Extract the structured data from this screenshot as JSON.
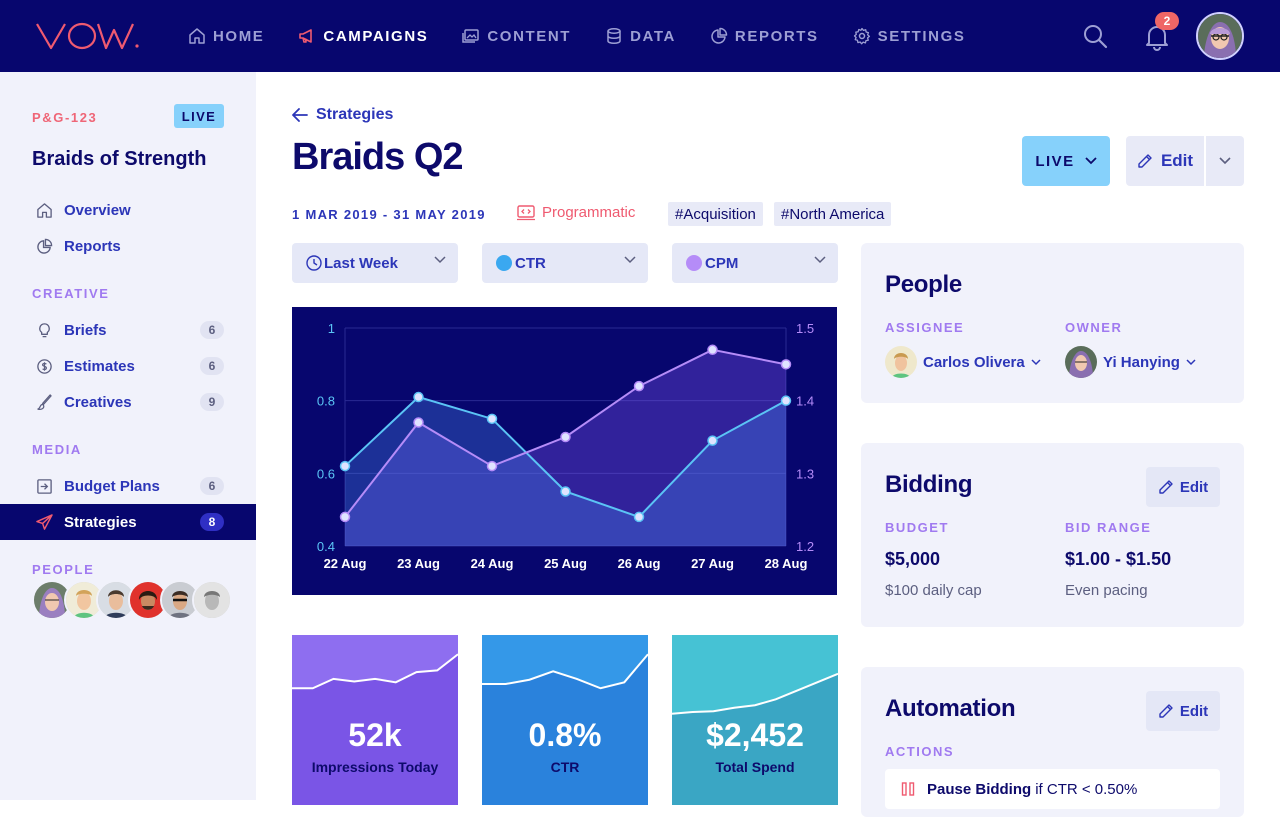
{
  "brand": {
    "logo_text": "VOW"
  },
  "nav": {
    "items": [
      {
        "label": "HOME",
        "icon": "home-icon"
      },
      {
        "label": "CAMPAIGNS",
        "icon": "megaphone-icon",
        "active": true
      },
      {
        "label": "CONTENT",
        "icon": "image-icon"
      },
      {
        "label": "DATA",
        "icon": "database-icon"
      },
      {
        "label": "REPORTS",
        "icon": "pie-chart-icon"
      },
      {
        "label": "SETTINGS",
        "icon": "gear-icon"
      }
    ],
    "notification_count": "2"
  },
  "sidebar": {
    "campaign_code": "P&G-123",
    "status": "LIVE",
    "campaign_name": "Braids of Strength",
    "items": [
      {
        "label": "Overview",
        "icon": "home-icon"
      },
      {
        "label": "Reports",
        "icon": "pie-chart-icon"
      }
    ],
    "creative_heading": "CREATIVE",
    "creative_items": [
      {
        "label": "Briefs",
        "count": "6",
        "icon": "lightbulb-icon"
      },
      {
        "label": "Estimates",
        "count": "6",
        "icon": "dollar-icon"
      },
      {
        "label": "Creatives",
        "count": "9",
        "icon": "brush-icon"
      }
    ],
    "media_heading": "MEDIA",
    "media_items": [
      {
        "label": "Budget Plans",
        "count": "6",
        "icon": "budget-icon"
      },
      {
        "label": "Strategies",
        "count": "8",
        "icon": "paper-plane-icon",
        "active": true
      }
    ],
    "people_heading": "PEOPLE"
  },
  "main": {
    "back_label": "Strategies",
    "title": "Braids Q2",
    "status_button": "LIVE",
    "edit_label": "Edit",
    "date_range": "1 MAR 2019 - 31 MAY 2019",
    "channel": "Programmatic",
    "tags": [
      "#Acquisition",
      "#North America"
    ],
    "filters": {
      "period": "Last Week",
      "metric_left": "CTR",
      "metric_right": "CPM"
    }
  },
  "colors": {
    "navy": "#07066e",
    "ctr_series": "#5bc4f5",
    "cpm_series": "#b58cf8",
    "accent_red": "#ef5a70",
    "live_blue": "#86d1fb"
  },
  "chart_data": {
    "type": "line",
    "categories": [
      "22 Aug",
      "23 Aug",
      "24 Aug",
      "25 Aug",
      "26 Aug",
      "27 Aug",
      "28 Aug"
    ],
    "y_left_ticks": [
      "1",
      "0.8",
      "0.6",
      "0.4"
    ],
    "y_right_ticks": [
      "1.5",
      "1.4",
      "1.3",
      "1.2"
    ],
    "ylim_left": [
      0.4,
      1.0
    ],
    "ylim_right": [
      1.2,
      1.5
    ],
    "series": [
      {
        "name": "CTR",
        "axis": "left",
        "values": [
          0.62,
          0.81,
          0.75,
          0.55,
          0.48,
          0.69,
          0.8
        ]
      },
      {
        "name": "CPM",
        "axis": "right",
        "values": [
          1.24,
          1.37,
          1.31,
          1.35,
          1.42,
          1.47,
          1.45
        ]
      }
    ],
    "grid": true
  },
  "kpis": [
    {
      "value": "52k",
      "label": "Impressions Today",
      "trend": [
        0.55,
        0.55,
        0.66,
        0.63,
        0.66,
        0.62,
        0.74,
        0.76,
        0.95
      ]
    },
    {
      "value": "0.8%",
      "label": "CTR",
      "trend": [
        0.6,
        0.6,
        0.65,
        0.75,
        0.66,
        0.55,
        0.62,
        0.95
      ]
    },
    {
      "value": "$2,452",
      "label": "Total Spend",
      "trend": [
        0.25,
        0.27,
        0.28,
        0.32,
        0.35,
        0.42,
        0.52,
        0.62,
        0.72
      ]
    }
  ],
  "people_card": {
    "title": "People",
    "assignee_label": "ASSIGNEE",
    "assignee_name": "Carlos Olivera",
    "owner_label": "OWNER",
    "owner_name": "Yi Hanying"
  },
  "bidding_card": {
    "title": "Bidding",
    "edit_label": "Edit",
    "budget_label": "BUDGET",
    "budget_value": "$5,000",
    "budget_note": "$100 daily cap",
    "range_label": "BID RANGE",
    "range_value": "$1.00 - $1.50",
    "range_note": "Even pacing"
  },
  "automation_card": {
    "title": "Automation",
    "edit_label": "Edit",
    "actions_label": "ACTIONS",
    "action_bold": "Pause Bidding",
    "action_rest": "if CTR < 0.50%"
  }
}
